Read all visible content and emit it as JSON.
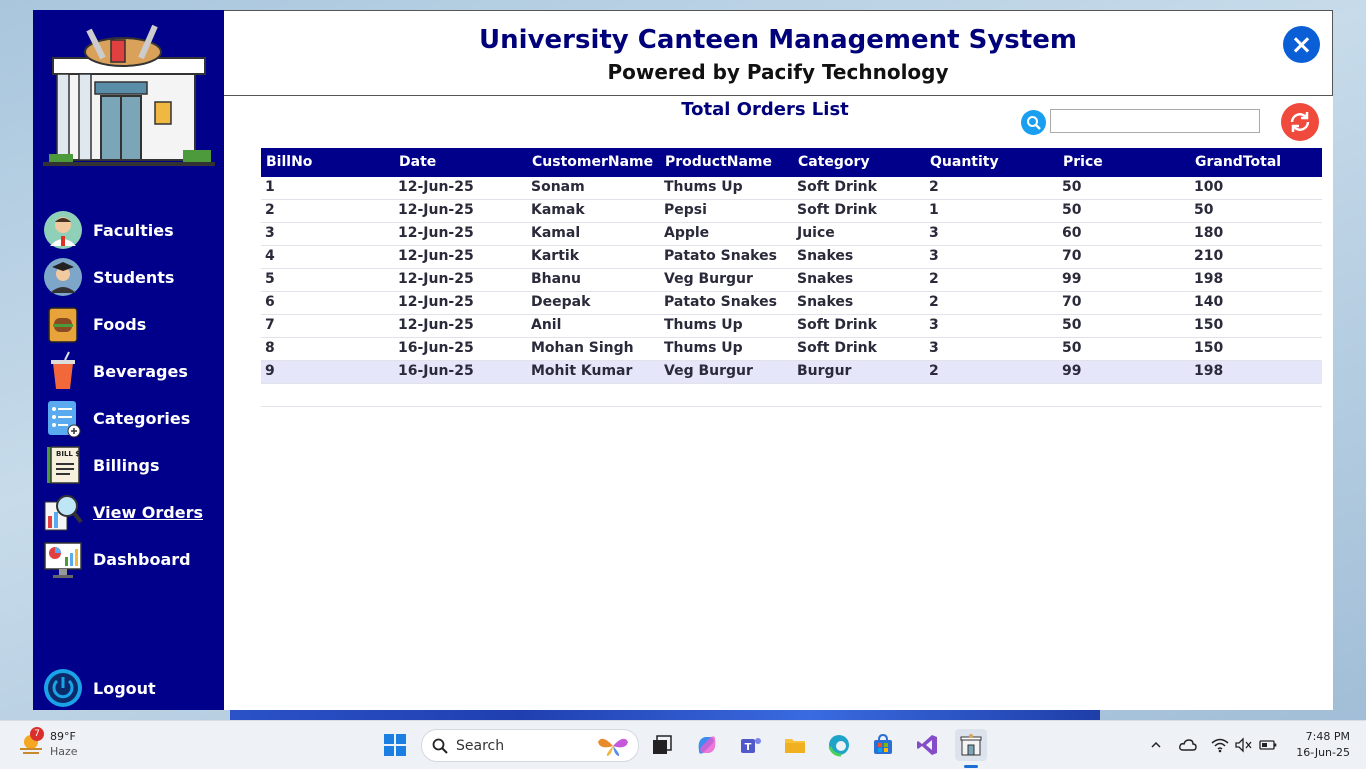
{
  "app": {
    "title": "University Canteen Management System",
    "subtitle": "Powered by Pacify Technology",
    "close_label": "×",
    "section_title": "Total Orders List",
    "search": {
      "value": "",
      "placeholder": ""
    }
  },
  "sidebar": {
    "items": [
      {
        "label": "Faculties",
        "icon": "faculty-icon"
      },
      {
        "label": "Students",
        "icon": "student-icon"
      },
      {
        "label": "Foods",
        "icon": "food-icon"
      },
      {
        "label": "Beverages",
        "icon": "beverage-icon"
      },
      {
        "label": "Categories",
        "icon": "category-icon"
      },
      {
        "label": "Billings",
        "icon": "bill-icon"
      },
      {
        "label": "View Orders",
        "icon": "view-orders-icon",
        "active": true
      },
      {
        "label": "Dashboard",
        "icon": "dashboard-icon"
      }
    ],
    "logout": "Logout",
    "bill_icon_text": "BILL $"
  },
  "grid": {
    "columns": [
      "BillNo",
      "Date",
      "CustomerName",
      "ProductName",
      "Category",
      "Quantity",
      "Price",
      "GrandTotal"
    ],
    "rows": [
      [
        "1",
        "12-Jun-25",
        "Sonam",
        "Thums Up",
        "Soft Drink",
        "2",
        "50",
        "100"
      ],
      [
        "2",
        "12-Jun-25",
        "Kamak",
        "Pepsi",
        "Soft Drink",
        "1",
        "50",
        "50"
      ],
      [
        "3",
        "12-Jun-25",
        "Kamal",
        "Apple",
        "Juice",
        "3",
        "60",
        "180"
      ],
      [
        "4",
        "12-Jun-25",
        "Kartik",
        "Patato Snakes",
        "Snakes",
        "3",
        "70",
        "210"
      ],
      [
        "5",
        "12-Jun-25",
        "Bhanu",
        "Veg Burgur",
        "Snakes",
        "2",
        "99",
        "198"
      ],
      [
        "6",
        "12-Jun-25",
        "Deepak",
        "Patato Snakes",
        "Snakes",
        "2",
        "70",
        "140"
      ],
      [
        "7",
        "12-Jun-25",
        "Anil",
        "Thums Up",
        "Soft Drink",
        "3",
        "50",
        "150"
      ],
      [
        "8",
        "16-Jun-25",
        "Mohan Singh",
        "Thums Up",
        "Soft Drink",
        "3",
        "50",
        "150"
      ],
      [
        "9",
        "16-Jun-25",
        "Mohit Kumar",
        "Veg Burgur",
        "Burgur",
        "2",
        "99",
        "198"
      ]
    ],
    "selected_row": 9
  },
  "taskbar": {
    "weather_temp": "89°F",
    "weather_desc": "Haze",
    "weather_badge": "7",
    "search_label": "Search",
    "time": "7:48 PM",
    "date": "16-Jun-25"
  },
  "colors": {
    "sidebar": "#00008b",
    "accent": "#0a5fd6",
    "refresh": "#ef4a3c",
    "selected": "#e6e6fa"
  }
}
